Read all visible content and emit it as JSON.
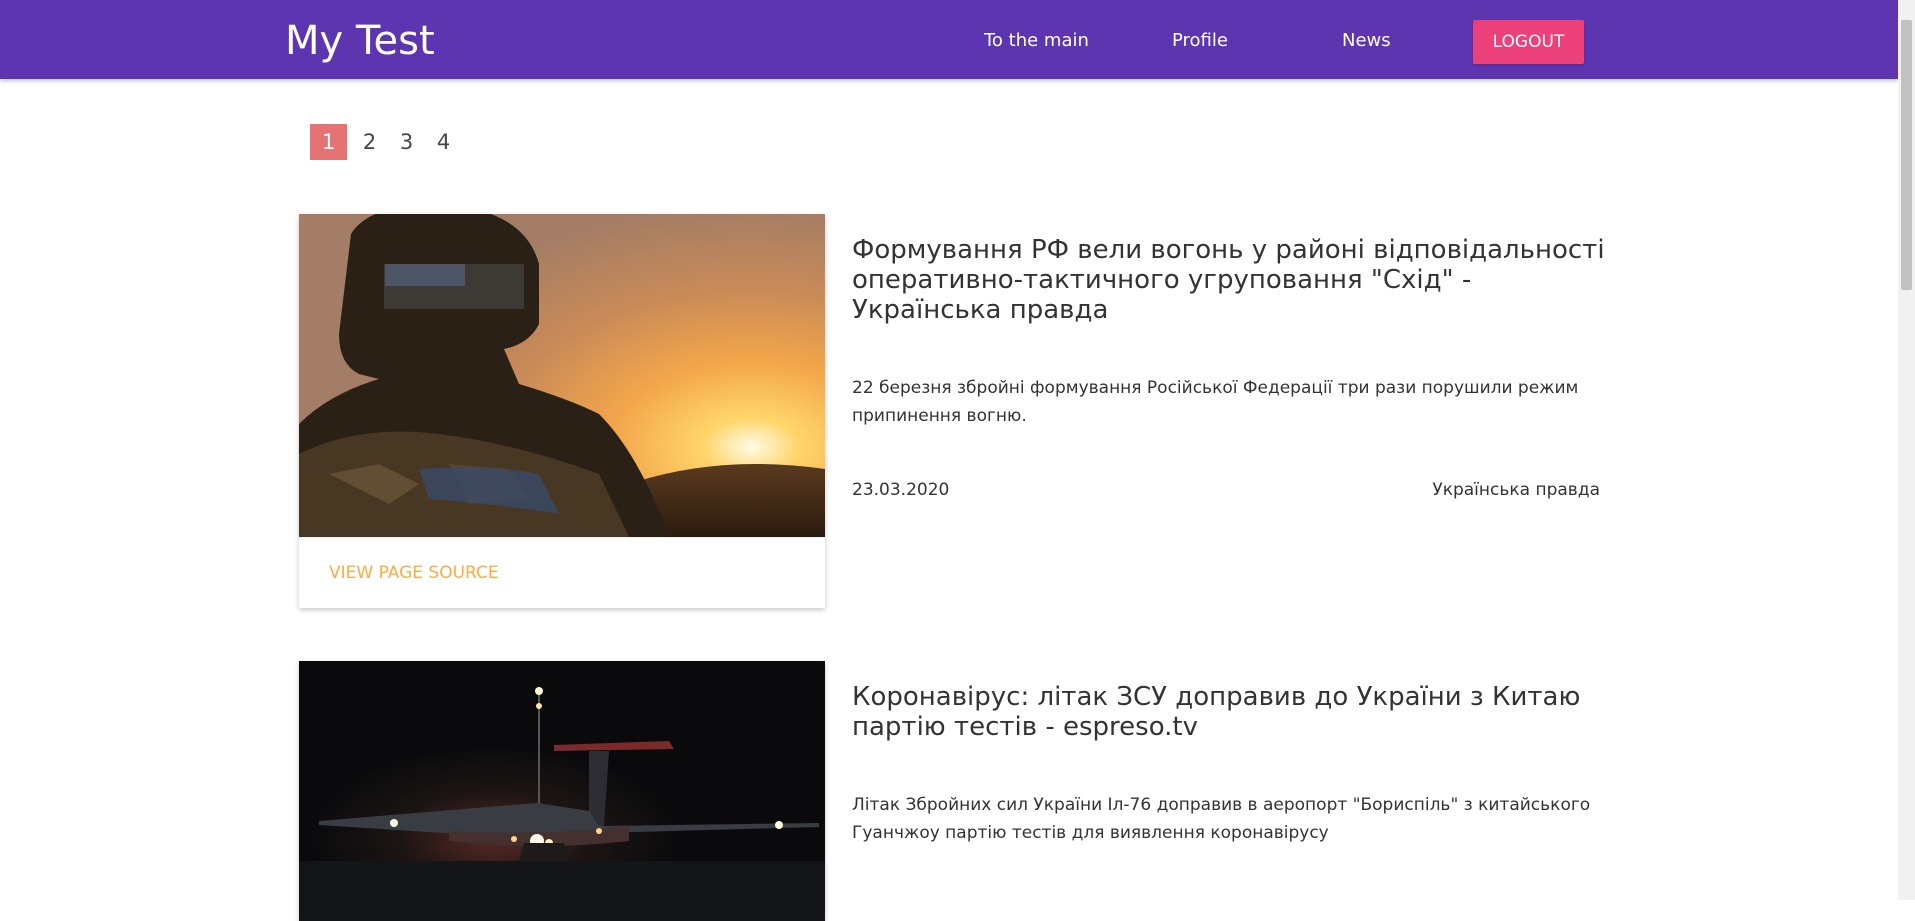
{
  "navbar": {
    "brand": "My Test",
    "links": [
      "To the main",
      "Profile",
      "News"
    ],
    "logout_label": "LOGOUT",
    "color": "#5e35b1"
  },
  "pagination": {
    "pages": [
      "1",
      "2",
      "3",
      "4"
    ],
    "active": "1"
  },
  "articles": [
    {
      "image_icon": "soldier-sunset-photo",
      "action_label": "VIEW PAGE SOURCE",
      "title": "Формування РФ вели вогонь у районі відповідальності оперативно-тактичного угруповання \"Схід\" - Українська правда",
      "description": "22 березня збройні формування Російської Федерації три рази порушили режим припинення вогню.",
      "date": "23.03.2020",
      "source": "Українська правда"
    },
    {
      "image_icon": "airplane-night-photo",
      "title": "Коронавірус: літак ЗСУ доправив до України з Китаю партію тестів - espreso.tv",
      "description": "Літак Збройних сил України Іл-76 доправив в аеропорт \"Бориспіль\" з китайського Гуанчжоу партію тестів для виявлення коронавірусу"
    }
  ]
}
